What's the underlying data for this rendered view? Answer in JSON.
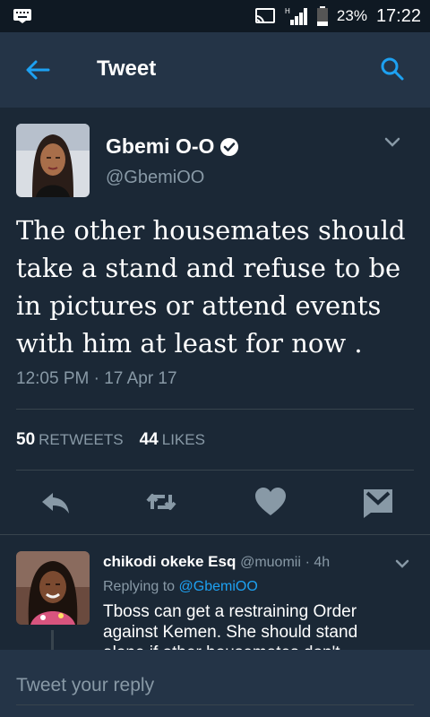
{
  "status_bar": {
    "battery": "23%",
    "time": "17:22",
    "icons": [
      "keyboard-icon",
      "cast-icon",
      "signal-icon",
      "battery-icon"
    ]
  },
  "app_bar": {
    "title": "Tweet",
    "icons": [
      "back-arrow-icon",
      "search-icon"
    ]
  },
  "tweet": {
    "author_name": "Gbemi O-O",
    "author_handle": "@GbemiOO",
    "verified": true,
    "text": "The other housemates should take a stand and refuse to be in pictures or attend events with him at least for now .",
    "timestamp": "12:05 PM · 17 Apr 17",
    "retweets_count": "50",
    "retweets_label": "RETWEETS",
    "likes_count": "44",
    "likes_label": "LIKES",
    "action_icons": [
      "reply-icon",
      "retweet-icon",
      "like-heart-icon",
      "direct-message-icon"
    ]
  },
  "reply": {
    "author_name": "chikodi okeke Esq",
    "author_handle": "@muomii",
    "time": "· 4h",
    "replying_prefix": "Replying to",
    "replying_to": "@GbemiOO",
    "text": "Tboss can get a restraining Order against Kemen. She should stand alone if other housemates don't"
  },
  "composer": {
    "placeholder": "Tweet your reply"
  },
  "colors": {
    "background": "#1b2836",
    "app_bar": "#243447",
    "accent": "#1da1f2",
    "muted_text": "#8899a6",
    "icon_gray": "#8899a6"
  }
}
